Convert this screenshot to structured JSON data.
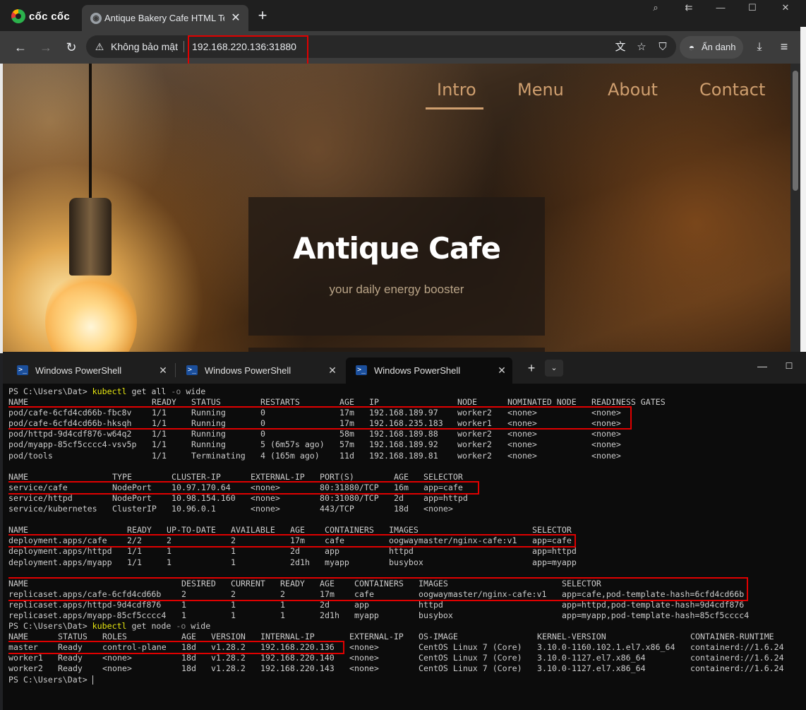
{
  "browser": {
    "brand": "cốc cốc",
    "tab_title": "Antique Bakery Cafe HTML Temp",
    "security_label": "Không bảo mật",
    "url": "192.168.220.136:31880",
    "incognito_label": "Ẩn danh"
  },
  "webpage": {
    "nav": [
      "Intro",
      "Menu",
      "About",
      "Contact"
    ],
    "hero_title": "Antique Cafe",
    "hero_subtitle": "your daily energy booster"
  },
  "terminal": {
    "tabs": [
      "Windows PowerShell",
      "Windows PowerShell",
      "Windows PowerShell"
    ],
    "prompt": "PS C:\\Users\\Dat>",
    "commands": [
      {
        "cmd": "kubectl",
        "rest": " get all ",
        "flag": "-o",
        "tail": " wide"
      },
      {
        "cmd": "kubectl",
        "rest": " get node ",
        "flag": "-o",
        "tail": " wide"
      }
    ],
    "pods": {
      "headers": [
        "NAME",
        "READY",
        "STATUS",
        "RESTARTS",
        "AGE",
        "IP",
        "NODE",
        "NOMINATED NODE",
        "READINESS GATES"
      ],
      "rows": [
        [
          "pod/cafe-6cfd4cd66b-fbc8v",
          "1/1",
          "Running",
          "0",
          "17m",
          "192.168.189.97",
          "worker2",
          "<none>",
          "<none>"
        ],
        [
          "pod/cafe-6cfd4cd66b-hksqh",
          "1/1",
          "Running",
          "0",
          "17m",
          "192.168.235.183",
          "worker1",
          "<none>",
          "<none>"
        ],
        [
          "pod/httpd-9d4cdf876-w64q2",
          "1/1",
          "Running",
          "0",
          "58m",
          "192.168.189.88",
          "worker2",
          "<none>",
          "<none>"
        ],
        [
          "pod/myapp-85cf5cccc4-vsv5p",
          "1/1",
          "Running",
          "5 (6m57s ago)",
          "57m",
          "192.168.189.92",
          "worker2",
          "<none>",
          "<none>"
        ],
        [
          "pod/tools",
          "1/1",
          "Terminating",
          "4 (165m ago)",
          "11d",
          "192.168.189.81",
          "worker2",
          "<none>",
          "<none>"
        ]
      ]
    },
    "services": {
      "headers": [
        "NAME",
        "TYPE",
        "CLUSTER-IP",
        "EXTERNAL-IP",
        "PORT(S)",
        "AGE",
        "SELECTOR"
      ],
      "rows": [
        [
          "service/cafe",
          "NodePort",
          "10.97.170.64",
          "<none>",
          "80:31880/TCP",
          "16m",
          "app=cafe"
        ],
        [
          "service/httpd",
          "NodePort",
          "10.98.154.160",
          "<none>",
          "80:31080/TCP",
          "2d",
          "app=httpd"
        ],
        [
          "service/kubernetes",
          "ClusterIP",
          "10.96.0.1",
          "<none>",
          "443/TCP",
          "18d",
          "<none>"
        ]
      ]
    },
    "deployments": {
      "headers": [
        "NAME",
        "READY",
        "UP-TO-DATE",
        "AVAILABLE",
        "AGE",
        "CONTAINERS",
        "IMAGES",
        "SELECTOR"
      ],
      "rows": [
        [
          "deployment.apps/cafe",
          "2/2",
          "2",
          "2",
          "17m",
          "cafe",
          "oogwaymaster/nginx-cafe:v1",
          "app=cafe"
        ],
        [
          "deployment.apps/httpd",
          "1/1",
          "1",
          "1",
          "2d",
          "app",
          "httpd",
          "app=httpd"
        ],
        [
          "deployment.apps/myapp",
          "1/1",
          "1",
          "1",
          "2d1h",
          "myapp",
          "busybox",
          "app=myapp"
        ]
      ]
    },
    "replicasets": {
      "headers": [
        "NAME",
        "DESIRED",
        "CURRENT",
        "READY",
        "AGE",
        "CONTAINERS",
        "IMAGES",
        "SELECTOR"
      ],
      "rows": [
        [
          "replicaset.apps/cafe-6cfd4cd66b",
          "2",
          "2",
          "2",
          "17m",
          "cafe",
          "oogwaymaster/nginx-cafe:v1",
          "app=cafe,pod-template-hash=6cfd4cd66b"
        ],
        [
          "replicaset.apps/httpd-9d4cdf876",
          "1",
          "1",
          "1",
          "2d",
          "app",
          "httpd",
          "app=httpd,pod-template-hash=9d4cdf876"
        ],
        [
          "replicaset.apps/myapp-85cf5cccc4",
          "1",
          "1",
          "1",
          "2d1h",
          "myapp",
          "busybox",
          "app=myapp,pod-template-hash=85cf5cccc4"
        ]
      ]
    },
    "nodes": {
      "headers": [
        "NAME",
        "STATUS",
        "ROLES",
        "AGE",
        "VERSION",
        "INTERNAL-IP",
        "EXTERNAL-IP",
        "OS-IMAGE",
        "KERNEL-VERSION",
        "CONTAINER-RUNTIME"
      ],
      "rows": [
        [
          "master",
          "Ready",
          "control-plane",
          "18d",
          "v1.28.2",
          "192.168.220.136",
          "<none>",
          "CentOS Linux 7 (Core)",
          "3.10.0-1160.102.1.el7.x86_64",
          "containerd://1.6.24"
        ],
        [
          "worker1",
          "Ready",
          "<none>",
          "18d",
          "v1.28.2",
          "192.168.220.140",
          "<none>",
          "CentOS Linux 7 (Core)",
          "3.10.0-1127.el7.x86_64",
          "containerd://1.6.24"
        ],
        [
          "worker2",
          "Ready",
          "<none>",
          "18d",
          "v1.28.2",
          "192.168.220.143",
          "<none>",
          "CentOS Linux 7 (Core)",
          "3.10.0-1127.el7.x86_64",
          "containerd://1.6.24"
        ]
      ]
    }
  }
}
